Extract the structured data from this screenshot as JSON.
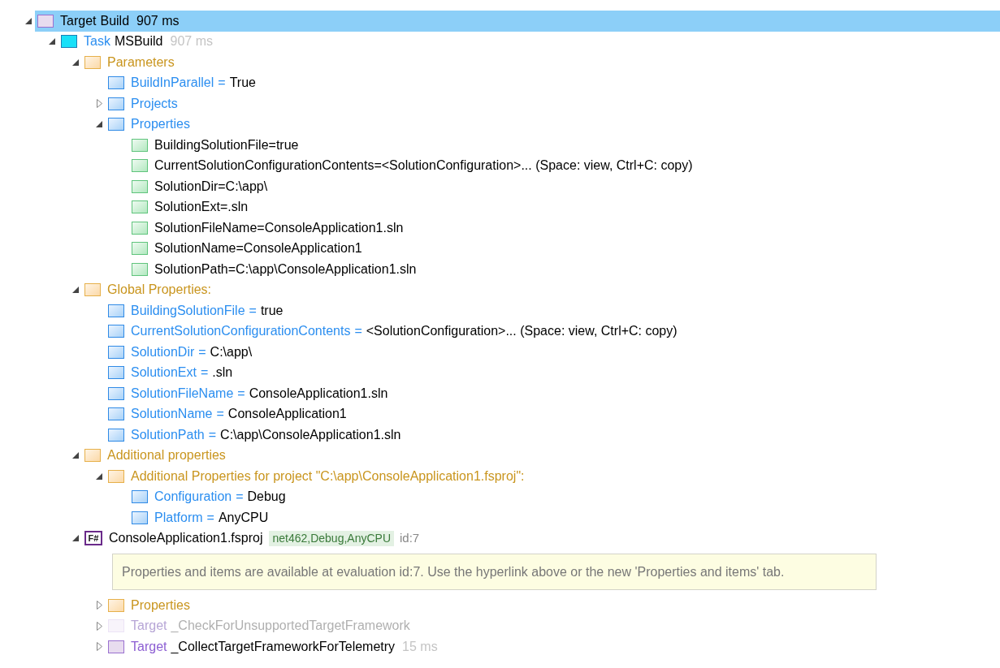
{
  "tree": [
    {
      "kind": "target",
      "label": "Target",
      "name": "Build",
      "duration": "907 ms",
      "dimmed": false,
      "selected": true,
      "expanded": true,
      "children": [
        {
          "kind": "task",
          "label": "Task",
          "name": "MSBuild",
          "duration": "907 ms",
          "selected": false,
          "expanded": true,
          "children": [
            {
              "kind": "folder",
              "name": "Parameters",
              "selected": false,
              "expanded": true,
              "children": [
                {
                  "kind": "parameter",
                  "name": "BuildInParallel",
                  "op": "=",
                  "value": "True",
                  "selected": false
                },
                {
                  "kind": "parameter",
                  "name": "Projects",
                  "selected": false,
                  "expanded": false
                },
                {
                  "kind": "parameter",
                  "name": "Properties",
                  "selected": false,
                  "expanded": true,
                  "children": [
                    {
                      "kind": "property",
                      "name": "BuildingSolutionFile=true",
                      "selected": false
                    },
                    {
                      "kind": "property",
                      "name": "CurrentSolutionConfigurationContents=<SolutionConfiguration>... (Space: view, Ctrl+C: copy)",
                      "selected": false
                    },
                    {
                      "kind": "property",
                      "name": "SolutionDir=C:\\app\\",
                      "selected": false
                    },
                    {
                      "kind": "property",
                      "name": "SolutionExt=.sln",
                      "selected": false
                    },
                    {
                      "kind": "property",
                      "name": "SolutionFileName=ConsoleApplication1.sln",
                      "selected": false
                    },
                    {
                      "kind": "property",
                      "name": "SolutionName=ConsoleApplication1",
                      "selected": false
                    },
                    {
                      "kind": "property",
                      "name": "SolutionPath=C:\\app\\ConsoleApplication1.sln",
                      "selected": false
                    }
                  ]
                }
              ]
            },
            {
              "kind": "folder",
              "name": "Global Properties:",
              "selected": false,
              "expanded": true,
              "children": [
                {
                  "kind": "parameter",
                  "name": "BuildingSolutionFile",
                  "op": "=",
                  "value": "true",
                  "selected": false
                },
                {
                  "kind": "parameter",
                  "name": "CurrentSolutionConfigurationContents",
                  "op": "=",
                  "value": "<SolutionConfiguration>... (Space: view, Ctrl+C: copy)",
                  "selected": false
                },
                {
                  "kind": "parameter",
                  "name": "SolutionDir",
                  "op": "=",
                  "value": "C:\\app\\",
                  "selected": false
                },
                {
                  "kind": "parameter",
                  "name": "SolutionExt",
                  "op": "=",
                  "value": ".sln",
                  "selected": false
                },
                {
                  "kind": "parameter",
                  "name": "SolutionFileName",
                  "op": "=",
                  "value": "ConsoleApplication1.sln",
                  "selected": false
                },
                {
                  "kind": "parameter",
                  "name": "SolutionName",
                  "op": "=",
                  "value": "ConsoleApplication1",
                  "selected": false
                },
                {
                  "kind": "parameter",
                  "name": "SolutionPath",
                  "op": "=",
                  "value": "C:\\app\\ConsoleApplication1.sln",
                  "selected": false
                }
              ]
            },
            {
              "kind": "folder",
              "name": "Additional properties",
              "selected": false,
              "expanded": true,
              "children": [
                {
                  "kind": "folder",
                  "name": "Additional Properties for project \"C:\\app\\ConsoleApplication1.fsproj\":",
                  "selected": false,
                  "expanded": true,
                  "children": [
                    {
                      "kind": "parameter",
                      "name": "Configuration",
                      "op": "=",
                      "value": "Debug",
                      "selected": false
                    },
                    {
                      "kind": "parameter",
                      "name": "Platform",
                      "op": "=",
                      "value": "AnyCPU",
                      "selected": false
                    }
                  ]
                }
              ]
            },
            {
              "kind": "project",
              "icon_text": "F#",
              "name": "ConsoleApplication1.fsproj",
              "badge": "net462,Debug,AnyCPU",
              "id": "id:7",
              "selected": false,
              "expanded": true,
              "children": [
                {
                  "kind": "note",
                  "text": "Properties and items are available at evaluation id:7. Use the hyperlink above or the new 'Properties and items' tab."
                },
                {
                  "kind": "folder",
                  "name": "Properties",
                  "selected": false,
                  "expanded": false
                },
                {
                  "kind": "target",
                  "label": "Target",
                  "name": "_CheckForUnsupportedTargetFramework",
                  "dimmed": true,
                  "selected": false,
                  "expanded": false
                },
                {
                  "kind": "target",
                  "label": "Target",
                  "name": "_CollectTargetFrameworkForTelemetry",
                  "duration": "15 ms",
                  "dimmed": false,
                  "selected": false,
                  "expanded": false
                }
              ]
            }
          ]
        }
      ]
    }
  ]
}
